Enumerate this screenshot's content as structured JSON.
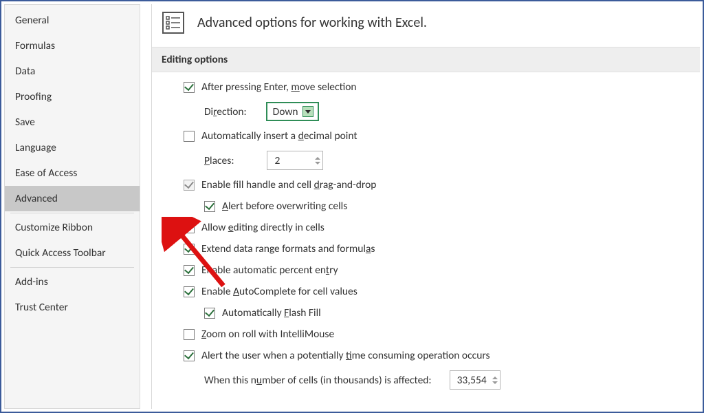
{
  "sidebar": {
    "groups": [
      [
        "General",
        "Formulas",
        "Data",
        "Proofing",
        "Save",
        "Language",
        "Ease of Access",
        "Advanced"
      ],
      [
        "Customize Ribbon",
        "Quick Access Toolbar"
      ],
      [
        "Add-ins",
        "Trust Center"
      ]
    ],
    "selected": "Advanced"
  },
  "header": {
    "title": "Advanced options for working with Excel."
  },
  "section": {
    "title": "Editing options"
  },
  "opts": {
    "after_enter": {
      "label_pre": "After pressing Enter, ",
      "label_u": "m",
      "label_post": "ove selection",
      "checked": true
    },
    "direction": {
      "label_pre": "Di",
      "label_u": "r",
      "label_post": "ection:",
      "value": "Down"
    },
    "auto_decimal": {
      "label_pre": "Automatically insert a ",
      "label_u": "d",
      "label_post": "ecimal point",
      "checked": false
    },
    "places": {
      "label_u": "P",
      "label_post": "laces:",
      "value": "2"
    },
    "fill_handle": {
      "label_pre": "Enable fill handle and cell ",
      "label_u": "d",
      "label_post": "rag-and-drop",
      "checked": true,
      "disabled": true
    },
    "alert_overwrite": {
      "label_u": "A",
      "label_post": "lert before overwriting cells",
      "checked": true
    },
    "allow_edit": {
      "label_pre": "Allow ",
      "label_u": "e",
      "label_post": "diting directly in cells",
      "checked": true
    },
    "extend_range": {
      "label_pre": "Extend data range formats and formul",
      "label_u": "a",
      "label_post": "s",
      "checked": true
    },
    "auto_percent": {
      "label_pre": "Enable automatic percent en",
      "label_u": "t",
      "label_post": "ry",
      "checked": true
    },
    "autocomplete": {
      "label_pre": "Enable ",
      "label_u": "A",
      "label_post": "utoComplete for cell values",
      "checked": true
    },
    "flash_fill": {
      "label_pre": "Automatically ",
      "label_u": "F",
      "label_post": "lash Fill",
      "checked": true
    },
    "zoom_mouse": {
      "label_u": "Z",
      "label_post": "oom on roll with IntelliMouse",
      "checked": false
    },
    "alert_time": {
      "label_pre": "Alert the user when a potentially ",
      "label_u": "t",
      "label_post": "ime consuming operation occurs",
      "checked": true
    },
    "cells_affected": {
      "label_pre": "When this n",
      "label_u": "u",
      "label_post": "mber of cells (in thousands) is affected:",
      "value": "33,554"
    }
  }
}
